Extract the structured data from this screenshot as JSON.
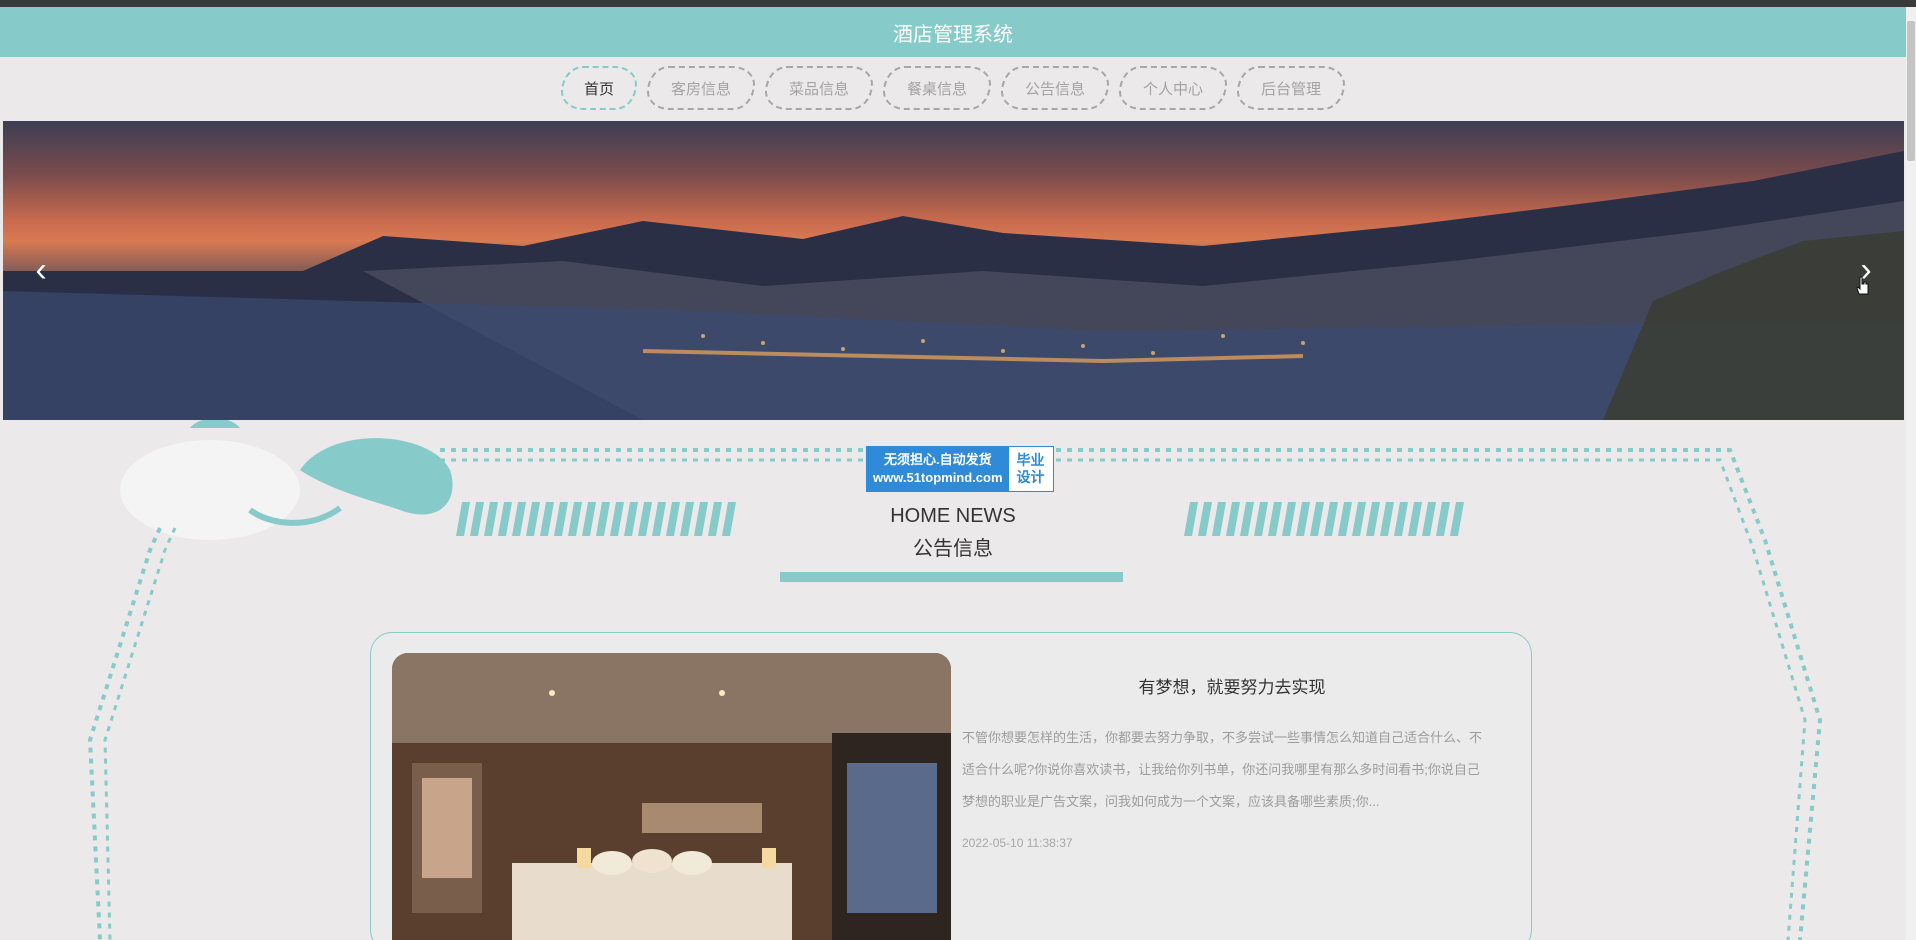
{
  "header": {
    "title": "酒店管理系统"
  },
  "nav": {
    "items": [
      {
        "label": "首页",
        "active": true
      },
      {
        "label": "客房信息",
        "active": false
      },
      {
        "label": "菜品信息",
        "active": false
      },
      {
        "label": "餐桌信息",
        "active": false
      },
      {
        "label": "公告信息",
        "active": false
      },
      {
        "label": "个人中心",
        "active": false
      },
      {
        "label": "后台管理",
        "active": false
      }
    ]
  },
  "carousel": {
    "prev_icon": "chevron-left-icon",
    "next_icon": "chevron-right-icon"
  },
  "watermark": {
    "line1": "无须担心.自动发货",
    "line2": "www.51topmind.com",
    "right1": "毕业",
    "right2": "设计"
  },
  "section": {
    "title_en": "HOME NEWS",
    "title_cn": "公告信息"
  },
  "news": {
    "title": "有梦想，就要努力去实现",
    "body": "不管你想要怎样的生活，你都要去努力争取，不多尝试一些事情怎么知道自己适合什么、不适合什么呢?你说你喜欢读书，让我给你列书单，你还问我哪里有那么多时间看书;你说自己梦想的职业是广告文案，问我如何成为一个文案，应该具备哪些素质;你...",
    "date": "2022-05-10 11:38:37"
  },
  "colors": {
    "accent": "#86cbca",
    "badge_blue": "#2f8bd7"
  }
}
